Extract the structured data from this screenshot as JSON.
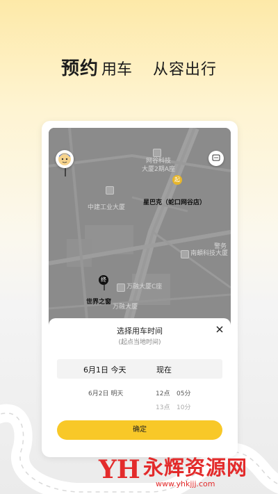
{
  "headline": {
    "bold": "预约",
    "normal": "用车",
    "slogan": "从容出行"
  },
  "map": {
    "labels": {
      "building_1": "网谷科技\n大厦2期A座",
      "starbucks": "星巴克（蛇口网谷店）",
      "cscec": "中建工业大厦",
      "nanjian": "南頔科技大厦",
      "wanrong_c": "万融大厦C座",
      "wanrong": "万融大厦",
      "window": "世界之窗",
      "partial": "警务"
    },
    "start_marker": "起",
    "end_marker": "终"
  },
  "sheet": {
    "title": "选择用车时间",
    "subtitle": "(起点当地时间)",
    "selected_date": "6月1日  今天",
    "selected_time": "现在",
    "date_option_2": "6月2日  明天",
    "hour_1": "12点",
    "minute_1": "05分",
    "hour_2": "13点",
    "minute_2": "10分",
    "confirm": "确定"
  },
  "watermark": {
    "brand": "永辉资源网",
    "url": "www.yhkjjj.com",
    "logo": "YH"
  },
  "colors": {
    "accent": "#f8c828",
    "map": "#8a8a8a",
    "watermark": "#e32b2b"
  }
}
